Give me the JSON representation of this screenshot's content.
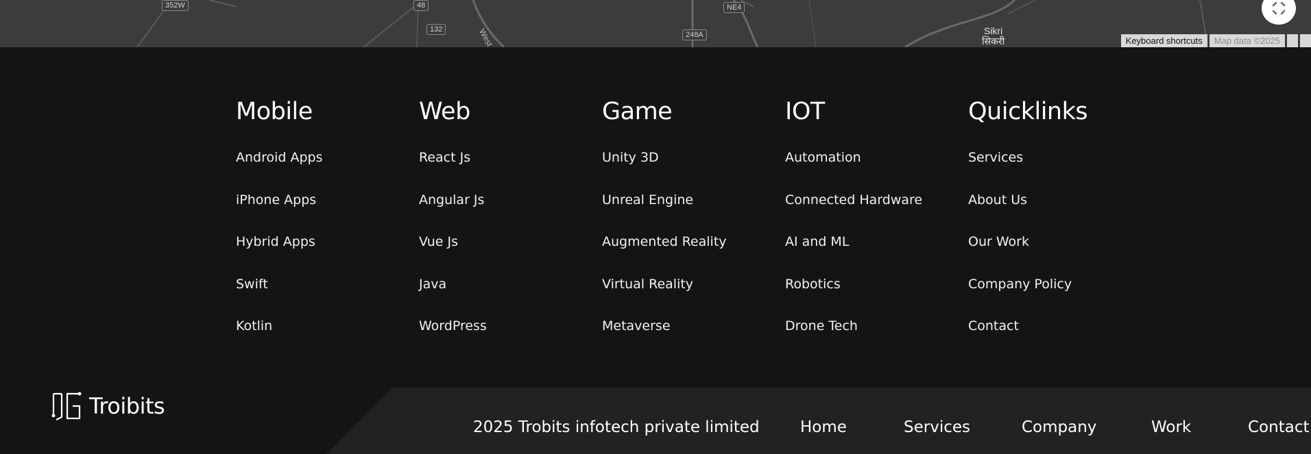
{
  "map": {
    "shields": [
      "352W",
      "48",
      "132",
      "NE4",
      "248A"
    ],
    "road_label": "West",
    "place_name": "Sikri",
    "place_name_local": "सिकरी",
    "keyboard_shortcuts": "Keyboard shortcuts",
    "map_data": "Map data ©2025",
    "fullscreen_icon": "fullscreen-icon"
  },
  "columns": [
    {
      "heading": "Mobile",
      "links": [
        "Android Apps",
        "iPhone Apps",
        "Hybrid Apps",
        "Swift",
        "Kotlin"
      ]
    },
    {
      "heading": "Web",
      "links": [
        "React Js",
        "Angular Js",
        "Vue Js",
        "Java",
        "WordPress"
      ]
    },
    {
      "heading": "Game",
      "links": [
        "Unity 3D",
        "Unreal Engine",
        "Augmented Reality",
        "Virtual Reality",
        "Metaverse"
      ]
    },
    {
      "heading": "IOT",
      "links": [
        "Automation",
        "Connected Hardware",
        "AI and ML",
        "Robotics",
        "Drone Tech"
      ]
    },
    {
      "heading": "Quicklinks",
      "links": [
        "Services",
        "About Us",
        "Our Work",
        "Company Policy",
        "Contact"
      ]
    }
  ],
  "footer": {
    "logo_text": "Troibits",
    "copyright": "2025 Trobits infotech private limited",
    "nav": [
      "Home",
      "Services",
      "Company",
      "Work",
      "Contact"
    ]
  },
  "colors": {
    "background": "#141414",
    "bottom_panel": "#222222",
    "map": "#3c3c3c",
    "text": "#ffffff"
  }
}
